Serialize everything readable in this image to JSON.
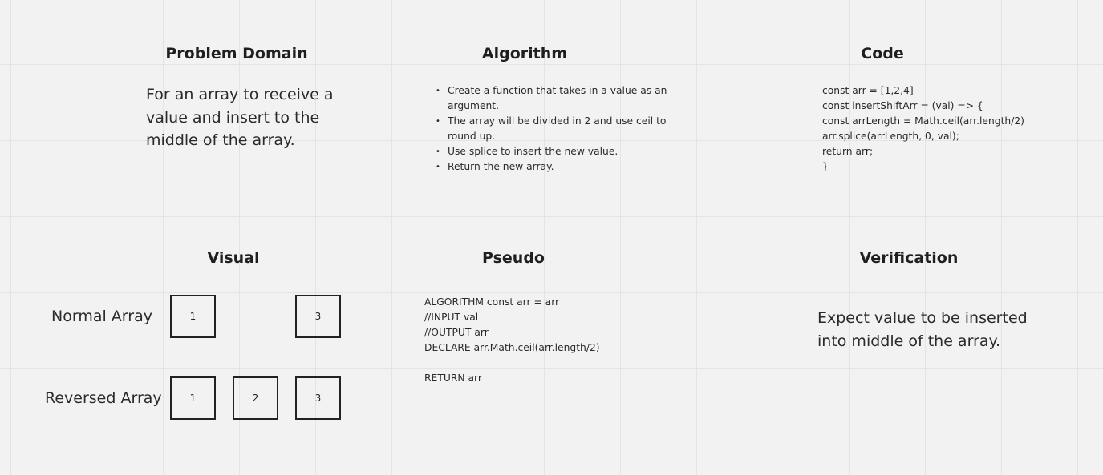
{
  "headings": {
    "problem_domain": "Problem Domain",
    "algorithm": "Algorithm",
    "code": "Code",
    "visual": "Visual",
    "pseudo": "Pseudo",
    "verification": "Verification"
  },
  "problem_domain": {
    "text": "For an array to receive a value and insert to the middle of the array."
  },
  "algorithm": {
    "steps": [
      "Create a function that takes in a value as an argument.",
      "The array will be divided in 2 and use ceil to round up.",
      "Use splice to insert the new value.",
      "Return the new array."
    ]
  },
  "code": {
    "lines": [
      "const arr = [1,2,4]",
      "const insertShiftArr = (val) => {",
      "const arrLength = Math.ceil(arr.length/2)",
      "arr.splice(arrLength, 0, val);",
      "return arr;",
      "}"
    ]
  },
  "visual": {
    "normal_label": "Normal Array",
    "reversed_label": "Reversed Array",
    "normal_boxes": [
      "1",
      "3"
    ],
    "reversed_boxes": [
      "1",
      "2",
      "3"
    ]
  },
  "pseudo": {
    "lines": [
      "ALGORITHM const arr = arr",
      "//INPUT val",
      "//OUTPUT arr",
      "DECLARE arr.Math.ceil(arr.length/2)",
      "",
      "RETURN arr"
    ]
  },
  "verification": {
    "text": "Expect value to be inserted into middle of the array."
  }
}
